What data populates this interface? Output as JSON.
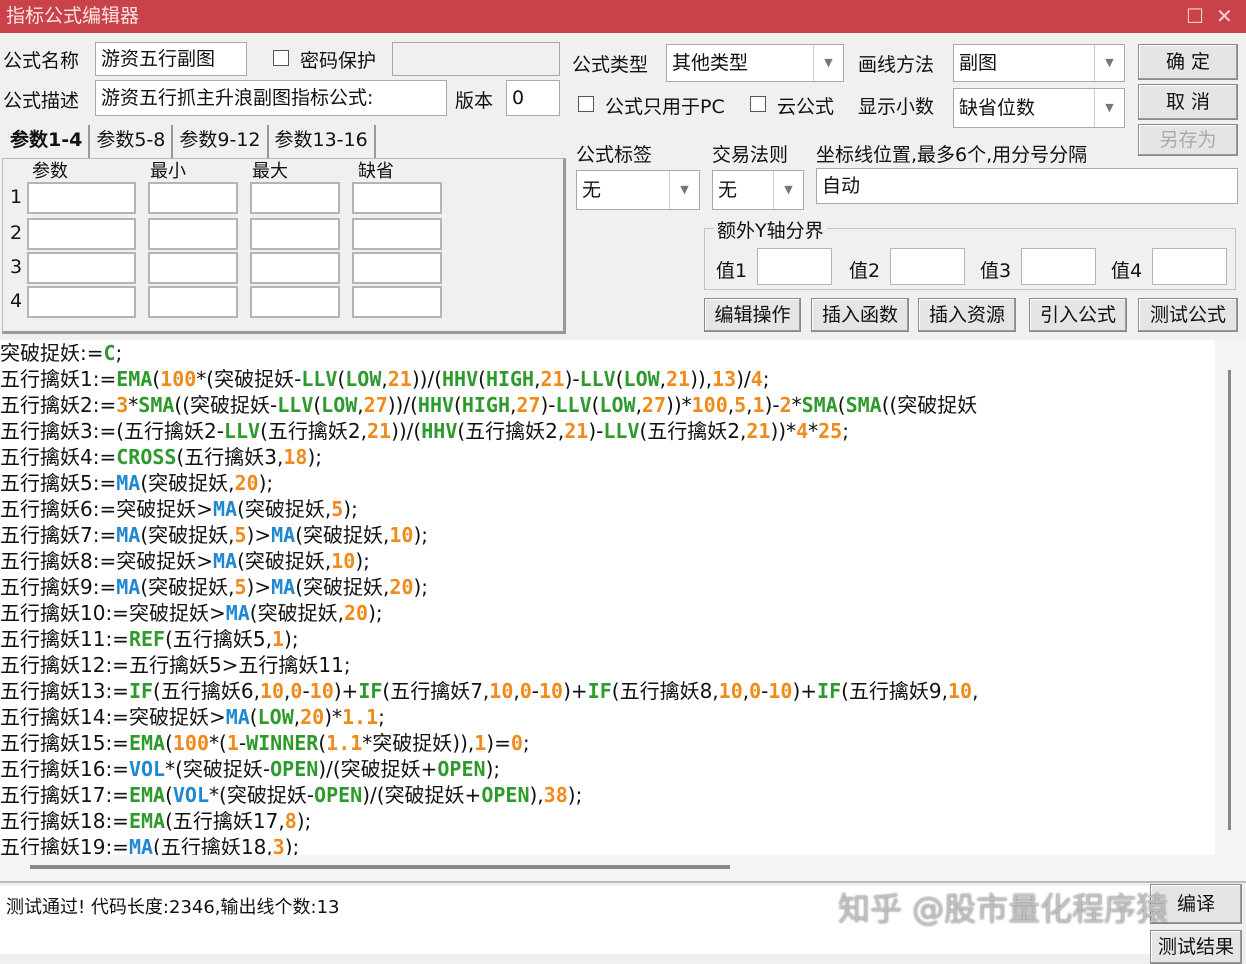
{
  "window": {
    "title": "指标公式编辑器",
    "maximize": "☐",
    "close": "✕"
  },
  "form": {
    "name_label": "公式名称",
    "name_value": "游资五行副图",
    "password_label": "密码保护",
    "desc_label": "公式描述",
    "desc_value": "游资五行抓主升浪副图指标公式:",
    "version_label": "版本",
    "version_value": "0",
    "type_label": "公式类型",
    "type_value": "其他类型",
    "draw_label": "画线方法",
    "draw_value": "副图",
    "pc_only_label": "公式只用于PC",
    "cloud_label": "云公式",
    "decimals_label": "显示小数",
    "decimals_value": "缺省位数",
    "tag_label": "公式标签",
    "tag_value": "无",
    "trade_label": "交易法则",
    "trade_value": "无",
    "axis_label": "坐标线位置,最多6个,用分号分隔",
    "axis_value": "自动",
    "yaxis_group": "额外Y轴分界",
    "y_labels": [
      "值1",
      "值2",
      "值3",
      "值4"
    ]
  },
  "buttons": {
    "ok": "确 定",
    "cancel": "取 消",
    "save_as": "另存为",
    "edit": "编辑操作",
    "insert_func": "插入函数",
    "insert_res": "插入资源",
    "import": "引入公式",
    "test": "测试公式",
    "compile": "编译",
    "test_result": "测试结果"
  },
  "params": {
    "tabs": [
      "参数1-4",
      "参数5-8",
      "参数9-12",
      "参数13-16"
    ],
    "headers": [
      "参数",
      "最小",
      "最大",
      "缺省"
    ],
    "rows": [
      "1",
      "2",
      "3",
      "4"
    ]
  },
  "code": [
    [
      [
        "t",
        "突破捉妖:="
      ],
      [
        "f",
        "C"
      ],
      [
        "t",
        ";"
      ]
    ],
    [
      [
        "t",
        "五行擒妖1:="
      ],
      [
        "f",
        "EMA"
      ],
      [
        "t",
        "("
      ],
      [
        "n",
        "100"
      ],
      [
        "t",
        "*(突破捉妖-"
      ],
      [
        "f",
        "LLV"
      ],
      [
        "t",
        "("
      ],
      [
        "f",
        "LOW"
      ],
      [
        "t",
        ","
      ],
      [
        "n",
        "21"
      ],
      [
        "t",
        "))/("
      ],
      [
        "f",
        "HHV"
      ],
      [
        "t",
        "("
      ],
      [
        "f",
        "HIGH"
      ],
      [
        "t",
        ","
      ],
      [
        "n",
        "21"
      ],
      [
        "t",
        ")-"
      ],
      [
        "f",
        "LLV"
      ],
      [
        "t",
        "("
      ],
      [
        "f",
        "LOW"
      ],
      [
        "t",
        ","
      ],
      [
        "n",
        "21"
      ],
      [
        "t",
        ")),"
      ],
      [
        "n",
        "13"
      ],
      [
        "t",
        ")/"
      ],
      [
        "n",
        "4"
      ],
      [
        "t",
        ";"
      ]
    ],
    [
      [
        "t",
        "五行擒妖2:="
      ],
      [
        "n",
        "3"
      ],
      [
        "t",
        "*"
      ],
      [
        "f",
        "SMA"
      ],
      [
        "t",
        "((突破捉妖-"
      ],
      [
        "f",
        "LLV"
      ],
      [
        "t",
        "("
      ],
      [
        "f",
        "LOW"
      ],
      [
        "t",
        ","
      ],
      [
        "n",
        "27"
      ],
      [
        "t",
        "))/("
      ],
      [
        "f",
        "HHV"
      ],
      [
        "t",
        "("
      ],
      [
        "f",
        "HIGH"
      ],
      [
        "t",
        ","
      ],
      [
        "n",
        "27"
      ],
      [
        "t",
        ")-"
      ],
      [
        "f",
        "LLV"
      ],
      [
        "t",
        "("
      ],
      [
        "f",
        "LOW"
      ],
      [
        "t",
        ","
      ],
      [
        "n",
        "27"
      ],
      [
        "t",
        "))*"
      ],
      [
        "n",
        "100"
      ],
      [
        "t",
        ","
      ],
      [
        "n",
        "5"
      ],
      [
        "t",
        ","
      ],
      [
        "n",
        "1"
      ],
      [
        "t",
        ")-"
      ],
      [
        "n",
        "2"
      ],
      [
        "t",
        "*"
      ],
      [
        "f",
        "SMA"
      ],
      [
        "t",
        "("
      ],
      [
        "f",
        "SMA"
      ],
      [
        "t",
        "((突破捉妖"
      ]
    ],
    [
      [
        "t",
        "五行擒妖3:=(五行擒妖2-"
      ],
      [
        "f",
        "LLV"
      ],
      [
        "t",
        "(五行擒妖2,"
      ],
      [
        "n",
        "21"
      ],
      [
        "t",
        "))/("
      ],
      [
        "f",
        "HHV"
      ],
      [
        "t",
        "(五行擒妖2,"
      ],
      [
        "n",
        "21"
      ],
      [
        "t",
        ")-"
      ],
      [
        "f",
        "LLV"
      ],
      [
        "t",
        "(五行擒妖2,"
      ],
      [
        "n",
        "21"
      ],
      [
        "t",
        "))*"
      ],
      [
        "n",
        "4"
      ],
      [
        "t",
        "*"
      ],
      [
        "n",
        "25"
      ],
      [
        "t",
        ";"
      ]
    ],
    [
      [
        "t",
        "五行擒妖4:="
      ],
      [
        "f",
        "CROSS"
      ],
      [
        "t",
        "(五行擒妖3,"
      ],
      [
        "n",
        "18"
      ],
      [
        "t",
        ");"
      ]
    ],
    [
      [
        "t",
        "五行擒妖5:="
      ],
      [
        "m",
        "MA"
      ],
      [
        "t",
        "(突破捉妖,"
      ],
      [
        "n",
        "20"
      ],
      [
        "t",
        ");"
      ]
    ],
    [
      [
        "t",
        "五行擒妖6:=突破捉妖>"
      ],
      [
        "m",
        "MA"
      ],
      [
        "t",
        "(突破捉妖,"
      ],
      [
        "n",
        "5"
      ],
      [
        "t",
        ");"
      ]
    ],
    [
      [
        "t",
        "五行擒妖7:="
      ],
      [
        "m",
        "MA"
      ],
      [
        "t",
        "(突破捉妖,"
      ],
      [
        "n",
        "5"
      ],
      [
        "t",
        ")>"
      ],
      [
        "m",
        "MA"
      ],
      [
        "t",
        "(突破捉妖,"
      ],
      [
        "n",
        "10"
      ],
      [
        "t",
        ");"
      ]
    ],
    [
      [
        "t",
        "五行擒妖8:=突破捉妖>"
      ],
      [
        "m",
        "MA"
      ],
      [
        "t",
        "(突破捉妖,"
      ],
      [
        "n",
        "10"
      ],
      [
        "t",
        ");"
      ]
    ],
    [
      [
        "t",
        "五行擒妖9:="
      ],
      [
        "m",
        "MA"
      ],
      [
        "t",
        "(突破捉妖,"
      ],
      [
        "n",
        "5"
      ],
      [
        "t",
        ")>"
      ],
      [
        "m",
        "MA"
      ],
      [
        "t",
        "(突破捉妖,"
      ],
      [
        "n",
        "20"
      ],
      [
        "t",
        ");"
      ]
    ],
    [
      [
        "t",
        "五行擒妖10:=突破捉妖>"
      ],
      [
        "m",
        "MA"
      ],
      [
        "t",
        "(突破捉妖,"
      ],
      [
        "n",
        "20"
      ],
      [
        "t",
        ");"
      ]
    ],
    [
      [
        "t",
        "五行擒妖11:="
      ],
      [
        "f",
        "REF"
      ],
      [
        "t",
        "(五行擒妖5,"
      ],
      [
        "n",
        "1"
      ],
      [
        "t",
        ");"
      ]
    ],
    [
      [
        "t",
        "五行擒妖12:=五行擒妖5>五行擒妖11;"
      ]
    ],
    [
      [
        "t",
        "五行擒妖13:="
      ],
      [
        "f",
        "IF"
      ],
      [
        "t",
        "(五行擒妖6,"
      ],
      [
        "n",
        "10"
      ],
      [
        "t",
        ","
      ],
      [
        "n",
        "0"
      ],
      [
        "t",
        "-"
      ],
      [
        "n",
        "10"
      ],
      [
        "t",
        ")+"
      ],
      [
        "f",
        "IF"
      ],
      [
        "t",
        "(五行擒妖7,"
      ],
      [
        "n",
        "10"
      ],
      [
        "t",
        ","
      ],
      [
        "n",
        "0"
      ],
      [
        "t",
        "-"
      ],
      [
        "n",
        "10"
      ],
      [
        "t",
        ")+"
      ],
      [
        "f",
        "IF"
      ],
      [
        "t",
        "(五行擒妖8,"
      ],
      [
        "n",
        "10"
      ],
      [
        "t",
        ","
      ],
      [
        "n",
        "0"
      ],
      [
        "t",
        "-"
      ],
      [
        "n",
        "10"
      ],
      [
        "t",
        ")+"
      ],
      [
        "f",
        "IF"
      ],
      [
        "t",
        "(五行擒妖9,"
      ],
      [
        "n",
        "10"
      ],
      [
        "t",
        ","
      ]
    ],
    [
      [
        "t",
        "五行擒妖14:=突破捉妖>"
      ],
      [
        "m",
        "MA"
      ],
      [
        "t",
        "("
      ],
      [
        "f",
        "LOW"
      ],
      [
        "t",
        ","
      ],
      [
        "n",
        "20"
      ],
      [
        "t",
        ")*"
      ],
      [
        "n",
        "1.1"
      ],
      [
        "t",
        ";"
      ]
    ],
    [
      [
        "t",
        "五行擒妖15:="
      ],
      [
        "f",
        "EMA"
      ],
      [
        "t",
        "("
      ],
      [
        "n",
        "100"
      ],
      [
        "t",
        "*("
      ],
      [
        "n",
        "1"
      ],
      [
        "t",
        "-"
      ],
      [
        "f",
        "WINNER"
      ],
      [
        "t",
        "("
      ],
      [
        "n",
        "1.1"
      ],
      [
        "t",
        "*突破捉妖)),"
      ],
      [
        "n",
        "1"
      ],
      [
        "t",
        ")="
      ],
      [
        "n",
        "0"
      ],
      [
        "t",
        ";"
      ]
    ],
    [
      [
        "t",
        "五行擒妖16:="
      ],
      [
        "m",
        "VOL"
      ],
      [
        "t",
        "*(突破捉妖-"
      ],
      [
        "f",
        "OPEN"
      ],
      [
        "t",
        ")/(突破捉妖+"
      ],
      [
        "f",
        "OPEN"
      ],
      [
        "t",
        ");"
      ]
    ],
    [
      [
        "t",
        "五行擒妖17:="
      ],
      [
        "f",
        "EMA"
      ],
      [
        "t",
        "("
      ],
      [
        "m",
        "VOL"
      ],
      [
        "t",
        "*(突破捉妖-"
      ],
      [
        "f",
        "OPEN"
      ],
      [
        "t",
        ")/(突破捉妖+"
      ],
      [
        "f",
        "OPEN"
      ],
      [
        "t",
        "),"
      ],
      [
        "n",
        "38"
      ],
      [
        "t",
        ");"
      ]
    ],
    [
      [
        "t",
        "五行擒妖18:="
      ],
      [
        "f",
        "EMA"
      ],
      [
        "t",
        "(五行擒妖17,"
      ],
      [
        "n",
        "8"
      ],
      [
        "t",
        ");"
      ]
    ],
    [
      [
        "t",
        "五行擒妖19:="
      ],
      [
        "m",
        "MA"
      ],
      [
        "t",
        "(五行擒妖18,"
      ],
      [
        "n",
        "3"
      ],
      [
        "t",
        ");"
      ]
    ]
  ],
  "status": {
    "message": "测试通过! 代码长度:2346,输出线个数:13"
  },
  "watermark": "知乎 @股市量化程序猿"
}
